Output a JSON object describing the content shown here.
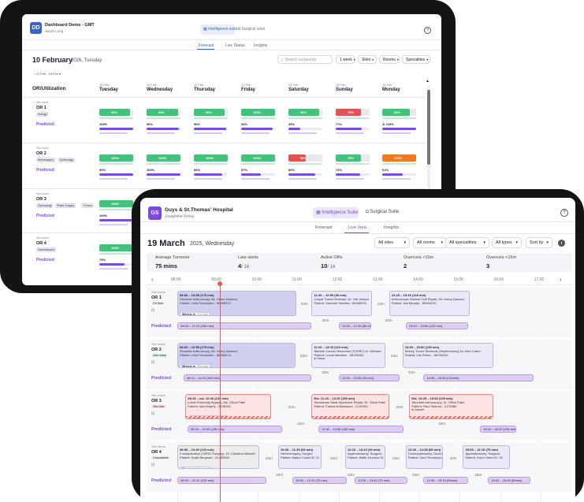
{
  "back": {
    "app_title": "Dashboard Demo - GMT",
    "app_user": "Sarah Long",
    "logo": "DD",
    "suite_tabs": [
      "Intelligence suite",
      "Surgical suite"
    ],
    "nav_tabs": [
      "Forecast",
      "Live Status",
      "Insights"
    ],
    "date_main": "10 February",
    "date_rest": "2026, Tuesday",
    "date_range": "10 Feb - 16 Feb",
    "search_placeholder": "Search surgeon/p",
    "filters": [
      "1 week",
      "Sites",
      "Rooms",
      "Specialties"
    ],
    "section_title": "OR/Utilization",
    "days": [
      {
        "date": "10 Feb",
        "name": "Tuesday"
      },
      {
        "date": "11 Feb",
        "name": "Wednesday"
      },
      {
        "date": "12 Feb",
        "name": "Thursday"
      },
      {
        "date": "13 Feb",
        "name": "Friday"
      },
      {
        "date": "14 Feb",
        "name": "Saturday"
      },
      {
        "date": "15 Feb",
        "name": "Sunday"
      },
      {
        "date": "16 Feb",
        "name": "Monday"
      }
    ],
    "site_label": "Site name",
    "predicted_label": "Predicted",
    "rooms": [
      {
        "name": "OR 1",
        "tags": [
          "Urology"
        ],
        "util": [
          {
            "v": "90%",
            "c": "green"
          },
          {
            "v": "93%",
            "c": "green"
          },
          {
            "v": "90%",
            "c": "green"
          },
          {
            "v": "100%",
            "c": "green"
          },
          {
            "v": "90%",
            "c": "green"
          },
          {
            "v": "75%",
            "c": "red"
          },
          {
            "v": "82%",
            "c": "green"
          }
        ],
        "pred": [
          "100%",
          "96%",
          "96%",
          "94%",
          "35%",
          "77%",
          "⚠ 115%"
        ]
      },
      {
        "name": "OR 2",
        "tags": [
          "Neurosurgery",
          "Gynecology"
        ],
        "util": [
          {
            "v": "100%",
            "c": "green"
          },
          {
            "v": "100%",
            "c": "green"
          },
          {
            "v": "100%",
            "c": "green"
          },
          {
            "v": "100%",
            "c": "green"
          },
          {
            "v": "50%",
            "c": "red"
          },
          {
            "v": "75%",
            "c": "green"
          },
          {
            "v": "125%",
            "c": "orange"
          }
        ],
        "pred": [
          "99%",
          "100%",
          "84%",
          "57%",
          "80%",
          "72%",
          "61%"
        ]
      },
      {
        "name": "OR 3",
        "tags": [
          "Gynecology",
          "Plastic Surgery",
          "+2 more"
        ],
        "util": [
          {
            "v": "100%",
            "c": "green"
          }
        ],
        "pred": [
          "100%"
        ]
      },
      {
        "name": "OR 4",
        "tags": [
          "Cardiothoracic"
        ],
        "util": [
          {
            "v": "100%",
            "c": "green"
          }
        ],
        "pred": [
          "75%"
        ]
      }
    ]
  },
  "front": {
    "logo": "GS",
    "app_title": "Guys & St.Thomas' Hospital",
    "app_user": "Josephine Finlay",
    "suite_tabs": [
      "Intelligence Suite",
      "Surgical Suite"
    ],
    "nav_tabs": [
      "Forecast",
      "Live View",
      "Insights"
    ],
    "date_main": "19 March",
    "date_rest": "2025, Wednesday",
    "filters": [
      "All sites",
      "All rooms",
      "All specialities",
      "All types",
      "Sort by"
    ],
    "stats": [
      {
        "label": "Average Turnover",
        "value": "75 mins"
      },
      {
        "label": "Late starts",
        "value": "4",
        "sub": "/ 16"
      },
      {
        "label": "Active ORs",
        "value": "10",
        "sub": "/ 16"
      },
      {
        "label": "Overruns >15m",
        "value": "2"
      },
      {
        "label": "Overruns <15m",
        "value": "3"
      }
    ],
    "times": [
      "08:00",
      "09:00",
      "10:00",
      "11:00",
      "12:00",
      "13:00",
      "14:00",
      "15:00",
      "16:00",
      "17:00"
    ],
    "site_label": "Site name",
    "predicted_label": "Predicted",
    "rooms": [
      {
        "name": "OR 1",
        "badge": "On time",
        "cases": [
          {
            "time": "08:00 – 10:55 (175 min)",
            "proc": "Shoulder Arthroscopy, Mr. Henry Dawson",
            "patient": "Patient: Leila Fernandez - 86346210",
            "status": "Wheels in",
            "status_time": "10m ago"
          },
          {
            "time": "11:20 – 12:50 (90 min)",
            "proc": "Carpal Tunnel Release, Dr. Jeff Joseph",
            "patient": "Patient: Yasmine Haddad - 86346394"
          },
          {
            "time": "13:15 – 15:15 (120 min)",
            "proc": "Arthroscopic Rotator Cuff Repair, Mr. Henry Dawson",
            "patient": "Patient: Isla Murphy - 86346210"
          }
        ],
        "gaps": [
          "22m",
          "22m"
        ],
        "pred": [
          "08:00 – 11:20 (180 min)",
          "12:00 – 12:20 (80 min)",
          "13:40 – 15:60 (120 min)"
        ],
        "pred_gaps": [
          "22m",
          "22m"
        ]
      },
      {
        "name": "OR 2",
        "badge": "10m early",
        "cases": [
          {
            "time": "08:00 – 10:55 (175 min)",
            "proc": "Shoulder Arthroscopy, Mr. Henry Dawson",
            "patient": "Patient: Leila Fernandez - 86566213",
            "status": "Wheels in",
            "status_time": "15m ago"
          },
          {
            "time": "11:20 – 13:10 (110 min)",
            "proc": "Bladder Cancer Resection (TURBT) Dr. Michael",
            "patient": "Patient: Lucas Martinez - 98765432",
            "tag": "Tumor"
          },
          {
            "time": "13:35 – 15:50 (135 min)",
            "proc": "Kidney Tumor Removal (Nephrectomy) Dr. Alex Carter",
            "patient": "Patient: Lila Petrov - 56783432"
          }
        ],
        "gaps": [
          "22m",
          "22m"
        ],
        "pred": [
          "08:10 – 11:20 (160 min)",
          "12:00 – 13:30 (90 min)",
          "14:05 – 16:50 (110min)"
        ],
        "pred_gaps": [
          "22m",
          "22m"
        ]
      },
      {
        "name": "OR 3",
        "badge": "25m late",
        "cases": [
          {
            "time": "08:15 – est. 10:20 (125 min)",
            "proc": "Lower Extremity Bypass, Ms. Olivia Patel",
            "patient": "Patient: Isla Murphy - 2138152",
            "status": "Start of procedure",
            "status_time": "5m ago"
          },
          {
            "time": "Est. 11:20 – 13:20 (155 min)",
            "proc": "Subclavian Steal Syndrome Repair, Dr. Olivia Patel",
            "patient": "Patient: Fatima Al-Mansouri - 2139152"
          },
          {
            "time": "Est. 13:45 – 15:50 (125 min)",
            "proc": "Shoulder Arthroscopy, Dr. Olivia Patel",
            "patient": "Patient: Ravi Sharma - 2170489",
            "tag": "Cancer"
          }
        ],
        "gaps": [
          "22m",
          "22m"
        ],
        "pred": [
          "08:15 – 10:30 (135 min)",
          "11:30 – 13:35 (155 min)",
          "15:30 – 16:20 (125 min)"
        ],
        "pred_gaps": [
          "22m",
          "22m"
        ]
      },
      {
        "name": "OR 4",
        "badge": "Unavailable",
        "cases": [
          {
            "time": "08:00 – 10:00 (120 min)",
            "proc": "Fundoplication (GERD Surgery), Dr. Christina Mitchell",
            "patient": "Patient: Noah Bergman - 51460934",
            "status": "Wheels out",
            "status_time": "5m ago"
          },
          {
            "time": "10:30 – 11:35 (65 min)",
            "proc": "Herniorrhaphy, Surgeo",
            "patient": "Patient: Mateo Costa ID: 21"
          },
          {
            "time": "12:10 – 13:10 (60 min)",
            "proc": "Appendectomy, Surgeon",
            "patient": "Patient: Malik Johnson ID"
          },
          {
            "time": "13:40 – 14:35 (55 min)",
            "proc": "Cholecystectomy, Doctor",
            "patient": "Patient: Zara Thompson ID"
          },
          {
            "time": "15:05 – 16:15 (70 min)",
            "proc": "Appendectomy, Surgeon",
            "patient": "Patient: Liam Carter ID: 52"
          }
        ],
        "gaps": [
          "22m",
          "22m",
          "22m",
          "22m"
        ],
        "pred": [
          "08:00 – 10:10 (130 min)",
          "10:50 – 12:10 (75 min)",
          "12:25 – 13:40 (75 min)",
          "14:05 – 15:10 (65min)",
          "15:40 – 16:45 (65min)"
        ],
        "pred_gaps": [
          "22m",
          "22m",
          "22m",
          "22m"
        ]
      }
    ]
  },
  "colors": {
    "accent": "#7b4bde",
    "brand_blue": "#3a63c9",
    "util_green": "#45c27a",
    "util_red": "#e05454",
    "util_orange": "#ee7a24",
    "card_blue": "#cfd0ef",
    "card_light": "#e9e9f7",
    "card_pink": "#fbe3e3",
    "pred_purple": "#dccdf6",
    "pred_dark": "#b69ae8",
    "now_line": "#e35b5b"
  }
}
